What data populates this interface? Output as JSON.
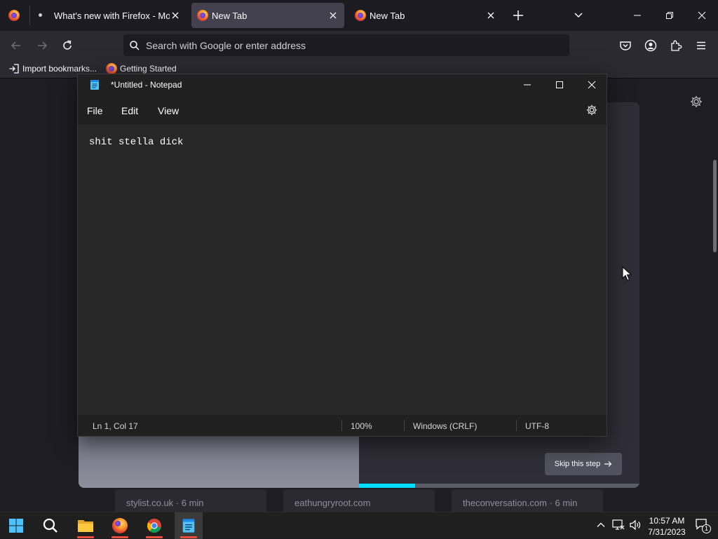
{
  "browser": {
    "tabs": [
      {
        "label": "What's new with Firefox - More"
      },
      {
        "label": "New Tab"
      },
      {
        "label": "New Tab"
      }
    ],
    "urlbar": {
      "placeholder": "Search with Google or enter address"
    },
    "bookmarks": [
      {
        "label": "Import bookmarks..."
      },
      {
        "label": "Getting Started"
      }
    ]
  },
  "newtab": {
    "skip_label": "Skip this step",
    "progress": 0.2,
    "stories": [
      {
        "source": "stylist.co.uk · 6 min"
      },
      {
        "source": "eathungryroot.com"
      },
      {
        "source": "theconversation.com · 6 min"
      }
    ]
  },
  "notepad": {
    "title": "*Untitled - Notepad",
    "menu": {
      "file": "File",
      "edit": "Edit",
      "view": "View"
    },
    "content": "shit stella dick",
    "status": {
      "position": "Ln 1, Col 17",
      "zoom": "100%",
      "line_ending": "Windows (CRLF)",
      "encoding": "UTF-8"
    }
  },
  "taskbar": {
    "time": "10:57 AM",
    "date": "7/31/2023",
    "notification_count": "1"
  },
  "colors": {
    "firefox_dark": "#1c1b22",
    "firefox_toolbar": "#2b2a33",
    "selected_tab": "#42414d",
    "notepad_bg": "#272727",
    "progress_accent": "#00ddff",
    "taskbar_running": "#e74c3c"
  }
}
